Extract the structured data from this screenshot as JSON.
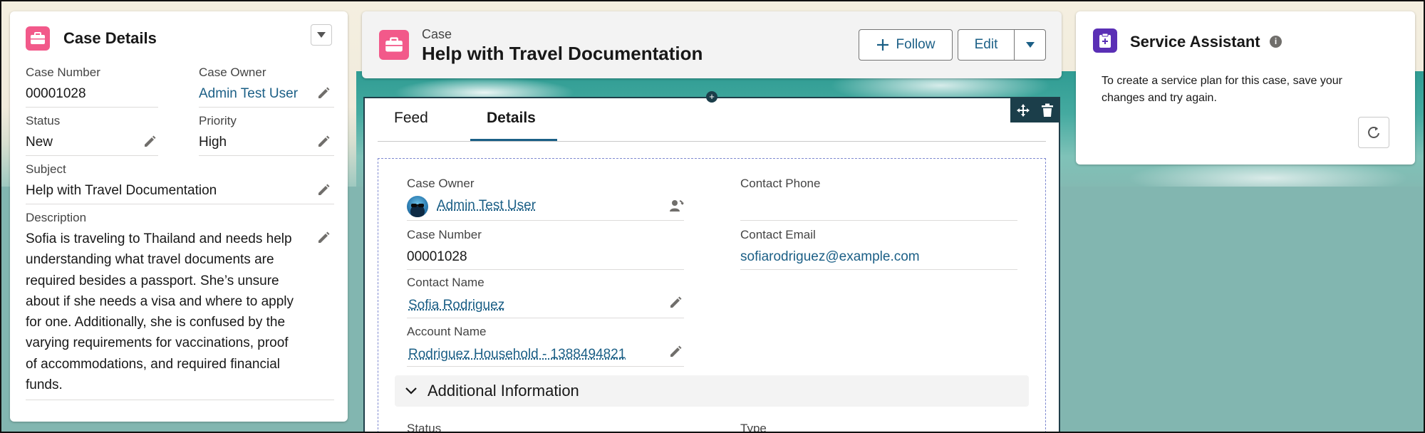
{
  "left_card": {
    "title": "Case Details",
    "fields": {
      "case_number_label": "Case Number",
      "case_number_value": "00001028",
      "case_owner_label": "Case Owner",
      "case_owner_value": "Admin Test User",
      "status_label": "Status",
      "status_value": "New",
      "priority_label": "Priority",
      "priority_value": "High",
      "subject_label": "Subject",
      "subject_value": "Help with Travel Documentation",
      "description_label": "Description",
      "description_lines": [
        "Sofia is traveling to Thailand and needs help",
        "understanding what travel documents are",
        "required besides a passport. She’s unsure",
        "about if she needs a visa and where to apply",
        "for one. Additionally, she is confused by the",
        "varying requirements for vaccinations, proof",
        "of accommodations, and required financial",
        "funds."
      ]
    }
  },
  "header": {
    "object_label": "Case",
    "title": "Help with Travel Documentation",
    "follow_label": "Follow",
    "edit_label": "Edit"
  },
  "tabs": [
    {
      "label": "Feed"
    },
    {
      "label": "Details"
    }
  ],
  "details": {
    "case_owner_label": "Case Owner",
    "case_owner_value": "Admin Test User",
    "contact_phone_label": "Contact Phone",
    "contact_phone_value": "",
    "case_number_label": "Case Number",
    "case_number_value": "00001028",
    "contact_email_label": "Contact Email",
    "contact_email_value": "sofiarodriguez@example.com",
    "contact_name_label": "Contact Name",
    "contact_name_value": "Sofia Rodriguez",
    "account_name_label": "Account Name",
    "account_name_value": "Rodriguez Household - 1388494821",
    "section_title": "Additional Information",
    "status_label": "Status",
    "type_label": "Type"
  },
  "service_assistant": {
    "title": "Service Assistant",
    "message_lines": [
      "To create a service plan for this case, save your",
      "changes and try again."
    ]
  },
  "colors": {
    "case_icon": "#f2598a",
    "link": "#1b5f86",
    "assistant_icon": "#5a2fb5",
    "toolbar": "#1b3e4a"
  }
}
